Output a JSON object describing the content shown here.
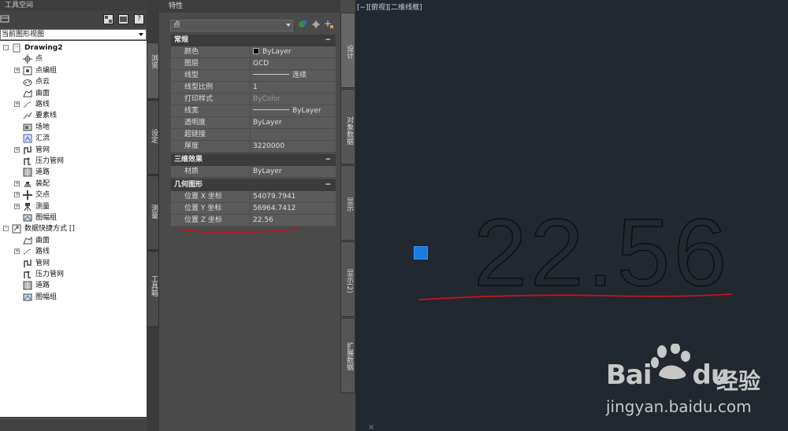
{
  "left_panel": {
    "title": "工具空间",
    "toolbar_icon": "toolspace-icon",
    "help_label": "?",
    "view_select": "当前图形视图",
    "tree": [
      {
        "label": "Drawing2",
        "level": 0,
        "expander": "-",
        "icon": "drawing-icon",
        "bold": true
      },
      {
        "label": "点",
        "level": 1,
        "expander": "",
        "icon": "point-icon"
      },
      {
        "label": "点编组",
        "level": 1,
        "expander": "+",
        "icon": "point-group-icon"
      },
      {
        "label": "点云",
        "level": 1,
        "expander": "",
        "icon": "point-cloud-icon"
      },
      {
        "label": "曲面",
        "level": 1,
        "expander": "",
        "icon": "surface-icon"
      },
      {
        "label": "路线",
        "level": 1,
        "expander": "+",
        "icon": "alignment-icon"
      },
      {
        "label": "要素线",
        "level": 1,
        "expander": "",
        "icon": "feature-line-icon"
      },
      {
        "label": "场地",
        "level": 1,
        "expander": "",
        "icon": "site-icon"
      },
      {
        "label": "汇流",
        "level": 1,
        "expander": "",
        "icon": "catchment-icon"
      },
      {
        "label": "管网",
        "level": 1,
        "expander": "+",
        "icon": "pipe-network-icon"
      },
      {
        "label": "压力管网",
        "level": 1,
        "expander": "",
        "icon": "pressure-network-icon"
      },
      {
        "label": "道路",
        "level": 1,
        "expander": "",
        "icon": "corridor-icon"
      },
      {
        "label": "装配",
        "level": 1,
        "expander": "+",
        "icon": "assembly-icon"
      },
      {
        "label": "交点",
        "level": 1,
        "expander": "+",
        "icon": "intersection-icon"
      },
      {
        "label": "测量",
        "level": 1,
        "expander": "+",
        "icon": "survey-icon"
      },
      {
        "label": "图幅组",
        "level": 1,
        "expander": "",
        "icon": "view-frame-icon"
      },
      {
        "label": "数据快捷方式 []",
        "level": 0,
        "expander": "-",
        "icon": "data-shortcut-icon",
        "bold": false
      },
      {
        "label": "曲面",
        "level": 1,
        "expander": "",
        "icon": "surface-icon"
      },
      {
        "label": "路线",
        "level": 1,
        "expander": "+",
        "icon": "alignment-icon"
      },
      {
        "label": "管网",
        "level": 1,
        "expander": "",
        "icon": "pipe-network-icon"
      },
      {
        "label": "压力管网",
        "level": 1,
        "expander": "",
        "icon": "pressure-network-icon"
      },
      {
        "label": "道路",
        "level": 1,
        "expander": "",
        "icon": "corridor-icon"
      },
      {
        "label": "图幅组",
        "level": 1,
        "expander": "",
        "icon": "view-frame-icon"
      }
    ]
  },
  "left_tabs": [
    "浏览",
    "设定",
    "测量",
    "工具箱"
  ],
  "properties": {
    "title": "特性",
    "object_select": "点",
    "sections": [
      {
        "title": "常规",
        "collapse": "−",
        "rows": [
          {
            "key": "颜色",
            "value": "ByLayer",
            "kind": "color"
          },
          {
            "key": "图层",
            "value": "GCD",
            "kind": "text"
          },
          {
            "key": "线型",
            "value": "连续",
            "kind": "linetype"
          },
          {
            "key": "线型比例",
            "value": "1",
            "kind": "text"
          },
          {
            "key": "打印样式",
            "value": "ByColor",
            "kind": "dim"
          },
          {
            "key": "线宽",
            "value": "ByLayer",
            "kind": "lineweight"
          },
          {
            "key": "透明度",
            "value": "ByLayer",
            "kind": "text"
          },
          {
            "key": "超链接",
            "value": "",
            "kind": "text"
          },
          {
            "key": "厚度",
            "value": "3220000",
            "kind": "text"
          }
        ]
      },
      {
        "title": "三维效果",
        "collapse": "−",
        "rows": [
          {
            "key": "材质",
            "value": "ByLayer",
            "kind": "text"
          }
        ]
      },
      {
        "title": "几何图形",
        "collapse": "−",
        "rows": [
          {
            "key": "位置 X 坐标",
            "value": "54079.7941",
            "kind": "text"
          },
          {
            "key": "位置 Y 坐标",
            "value": "56964.7412",
            "kind": "text"
          },
          {
            "key": "位置 Z 坐标",
            "value": "22.56",
            "kind": "text"
          }
        ]
      }
    ]
  },
  "right_tabs": [
    "设计",
    "对象数据",
    "显示",
    "显示(2)",
    "扩展数据"
  ],
  "viewport": {
    "label": "[−][俯视][二维线框]",
    "big_text": "22.56",
    "marker_color": "#1a7be0",
    "underline_color": "#c0141c"
  },
  "watermark": {
    "brand": "Bai",
    "brand2": "du",
    "cn": "经验",
    "url": "jingyan.baidu.com"
  },
  "cross_icon": "×"
}
